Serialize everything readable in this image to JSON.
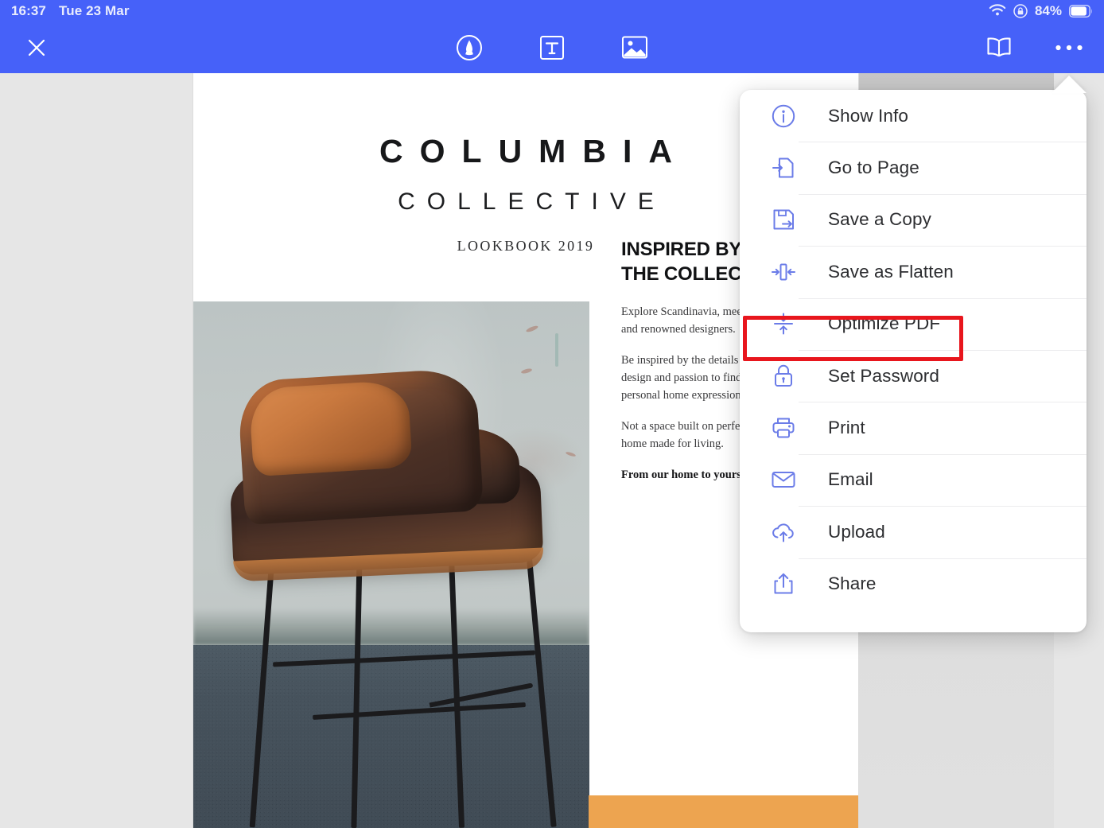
{
  "status_bar": {
    "time": "16:37",
    "date": "Tue 23 Mar",
    "battery_percent": "84%",
    "icons": [
      "wifi-icon",
      "rotation-lock-icon",
      "battery-icon"
    ]
  },
  "toolbar": {
    "close_label": "×",
    "icons": [
      {
        "name": "annotate-pen-icon",
        "label": "Annotate"
      },
      {
        "name": "text-box-icon",
        "label": "Text"
      },
      {
        "name": "image-insert-icon",
        "label": "Image"
      },
      {
        "name": "book-reader-icon",
        "label": "Reader"
      },
      {
        "name": "more-options-icon",
        "label": "More"
      }
    ],
    "accent_color": "#4661f9"
  },
  "document": {
    "cover_title": "COLUMBIA",
    "cover_subtitle": "COLLECTIVE",
    "cover_tagline": "LOOKBOOK 2019",
    "heading_line1": "INSPIRED BY",
    "heading_line2": "THE COLLECTION",
    "paragraphs": [
      "Explore Scandinavia, meet local\nand renowned designers.",
      "Be inspired by the details of craft,\ndesign and passion to find your\npersonal home expression.",
      "Not a space built on perfection, but a\nhome made for living."
    ],
    "closing_line": "From our home to yours.",
    "accent_band_color": "#eda450"
  },
  "menu": {
    "highlighted_item": "Optimize PDF",
    "highlight_color": "#e8161d",
    "icon_color": "#6b7ce8",
    "items": [
      {
        "label": "Show Info",
        "icon": "info-circle-icon"
      },
      {
        "label": "Go to Page",
        "icon": "go-to-page-icon"
      },
      {
        "label": "Save a Copy",
        "icon": "save-copy-icon"
      },
      {
        "label": "Save as Flatten",
        "icon": "flatten-icon"
      },
      {
        "label": "Optimize PDF",
        "icon": "compress-icon"
      },
      {
        "label": "Set Password",
        "icon": "lock-icon"
      },
      {
        "label": "Print",
        "icon": "printer-icon"
      },
      {
        "label": "Email",
        "icon": "envelope-icon"
      },
      {
        "label": "Upload",
        "icon": "cloud-upload-icon"
      },
      {
        "label": "Share",
        "icon": "share-icon"
      }
    ]
  }
}
